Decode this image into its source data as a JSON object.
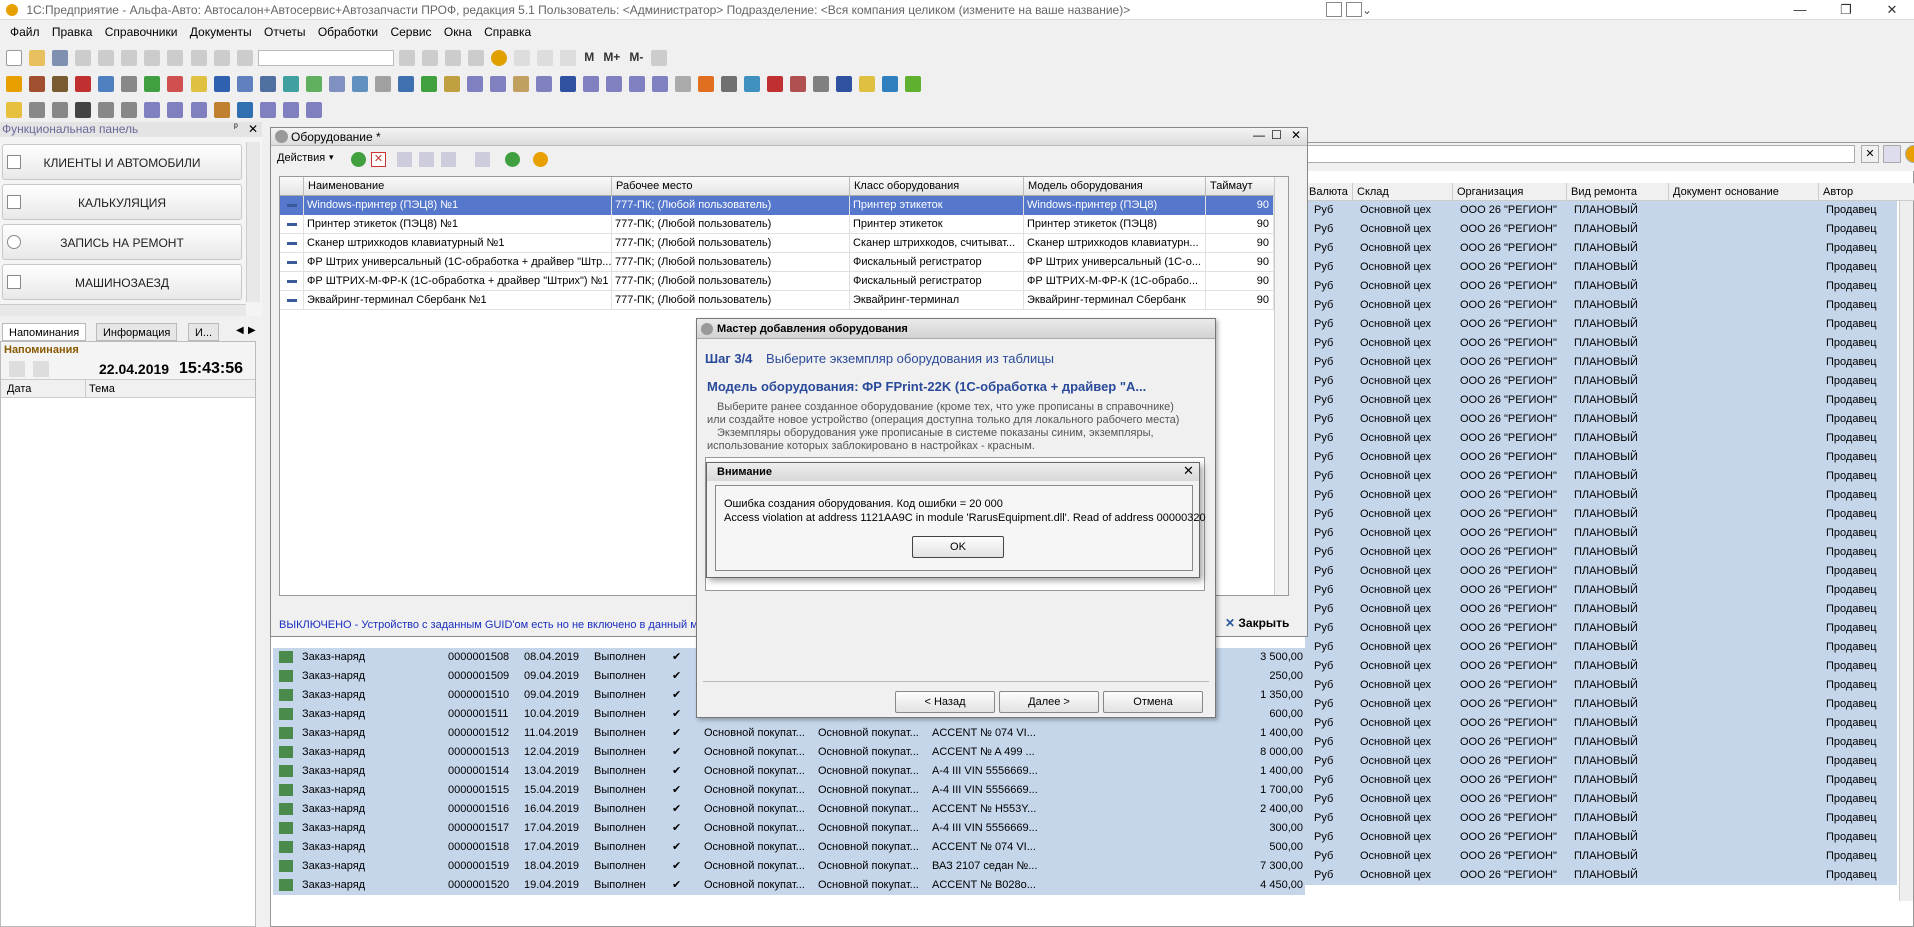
{
  "app": {
    "title": "1С:Предприятие - Альфа-Авто: Автосалон+Автосервис+Автозапчасти ПРОФ, редакция 5.1     Пользователь: <Администратор>     Подразделение: <Вся компания целиком (измените на ваше название)>",
    "minimize": "—",
    "restore": "❐",
    "close": "✕"
  },
  "menu": [
    "Файл",
    "Правка",
    "Справочники",
    "Документы",
    "Отчеты",
    "Обработки",
    "Сервис",
    "Окна",
    "Справка"
  ],
  "toolbar_text": {
    "m": "M",
    "mplus": "M+",
    "mminus": "M-"
  },
  "func_panel": {
    "title": "Функциональная панель",
    "pin": "ᵖ",
    "items": [
      "КЛИЕНТЫ И АВТОМОБИЛИ",
      "КАЛЬКУЛЯЦИЯ",
      "ЗАПИСЬ НА РЕМОНТ",
      "МАШИНОЗАЕЗД"
    ]
  },
  "left_tabs": [
    "Напоминания",
    "Информация",
    "И..."
  ],
  "reminders": {
    "title": "Напоминания",
    "date": "22.04.2019",
    "time": "15:43:56",
    "col_date": "Дата",
    "col_topic": "Тема"
  },
  "main_list": {
    "headers": [
      "Валюта",
      "Склад",
      "Организация",
      "Вид ремонта",
      "Документ основание",
      "Автор"
    ],
    "bg_rows": {
      "currency": "Руб",
      "warehouse": "Основной цех",
      "org": "ООО 26 \"РЕГИОН\"",
      "repair": "ПЛАНОВЫЙ",
      "author": "Продавец"
    },
    "rows": [
      {
        "doc": "Заказ-наряд",
        "num": "0000001508",
        "date": "08.04.2019",
        "status": "Выполнен",
        "client": "",
        "contract": "",
        "car": "",
        "sum": "3 500,00"
      },
      {
        "doc": "Заказ-наряд",
        "num": "0000001509",
        "date": "09.04.2019",
        "status": "Выполнен",
        "client": "",
        "contract": "",
        "car": "",
        "sum": "250,00"
      },
      {
        "doc": "Заказ-наряд",
        "num": "0000001510",
        "date": "09.04.2019",
        "status": "Выполнен",
        "client": "",
        "contract": "",
        "car": "",
        "sum": "1 350,00"
      },
      {
        "doc": "Заказ-наряд",
        "num": "0000001511",
        "date": "10.04.2019",
        "status": "Выполнен",
        "client": "",
        "contract": "",
        "car": "",
        "sum": "600,00"
      },
      {
        "doc": "Заказ-наряд",
        "num": "0000001512",
        "date": "11.04.2019",
        "status": "Выполнен",
        "client": "Основной покупат...",
        "contract": "Основной покупат...",
        "car": "ACCENT № 074 VI...",
        "sum": "1 400,00"
      },
      {
        "doc": "Заказ-наряд",
        "num": "0000001513",
        "date": "12.04.2019",
        "status": "Выполнен",
        "client": "Основной покупат...",
        "contract": "Основной покупат...",
        "car": "ACCENT № A 499 ...",
        "sum": "8 000,00"
      },
      {
        "doc": "Заказ-наряд",
        "num": "0000001514",
        "date": "13.04.2019",
        "status": "Выполнен",
        "client": "Основной покупат...",
        "contract": "Основной покупат...",
        "car": "A-4 III VIN 5556669...",
        "sum": "1 400,00"
      },
      {
        "doc": "Заказ-наряд",
        "num": "0000001515",
        "date": "15.04.2019",
        "status": "Выполнен",
        "client": "Основной покупат...",
        "contract": "Основной покупат...",
        "car": "A-4 III VIN 5556669...",
        "sum": "1 700,00"
      },
      {
        "doc": "Заказ-наряд",
        "num": "0000001516",
        "date": "16.04.2019",
        "status": "Выполнен",
        "client": "Основной покупат...",
        "contract": "Основной покупат...",
        "car": "ACCENT № H553Y...",
        "sum": "2 400,00"
      },
      {
        "doc": "Заказ-наряд",
        "num": "0000001517",
        "date": "17.04.2019",
        "status": "Выполнен",
        "client": "Основной покупат...",
        "contract": "Основной покупат...",
        "car": "A-4 III VIN 5556669...",
        "sum": "300,00"
      },
      {
        "doc": "Заказ-наряд",
        "num": "0000001518",
        "date": "17.04.2019",
        "status": "Выполнен",
        "client": "Основной покупат...",
        "contract": "Основной покупат...",
        "car": "ACCENT № 074 VI...",
        "sum": "500,00"
      },
      {
        "doc": "Заказ-наряд",
        "num": "0000001519",
        "date": "18.04.2019",
        "status": "Выполнен",
        "client": "Основной покупат...",
        "contract": "Основной покупат...",
        "car": "ВАЗ 2107 седан №...",
        "sum": "7 300,00"
      },
      {
        "doc": "Заказ-наряд",
        "num": "0000001520",
        "date": "19.04.2019",
        "status": "Выполнен",
        "client": "Основной покупат...",
        "contract": "Основной покупат...",
        "car": "ACCENT № B028o...",
        "sum": "4 450,00"
      }
    ]
  },
  "equipment": {
    "title": "Оборудование *",
    "actions": "Действия",
    "headers": [
      "Наименование",
      "Рабочее место",
      "Класс оборудования",
      "Модель оборудования",
      "Таймаут"
    ],
    "rows": [
      {
        "name": "Windows-принтер (ПЭЦ8) №1",
        "place": "777-ПК; (Любой пользователь)",
        "cls": "Принтер этикеток",
        "model": "Windows-принтер (ПЭЦ8)",
        "timeout": "90"
      },
      {
        "name": "Принтер этикеток (ПЭЦ8) №1",
        "place": "777-ПК; (Любой пользователь)",
        "cls": "Принтер этикеток",
        "model": "Принтер этикеток (ПЭЦ8)",
        "timeout": "90"
      },
      {
        "name": "Сканер штрихкодов клавиатурный №1",
        "place": "777-ПК; (Любой пользователь)",
        "cls": "Сканер штрихкодов, считыват...",
        "model": "Сканер штрихкодов клавиатурн...",
        "timeout": "90"
      },
      {
        "name": "ФР Штрих универсальный (1С-обработка + драйвер \"Штр...",
        "place": "777-ПК; (Любой пользователь)",
        "cls": "Фискальный регистратор",
        "model": "ФР Штрих универсальный (1С-о...",
        "timeout": "90"
      },
      {
        "name": "ФР ШТРИХ-М-ФР-К (1С-обработка + драйвер \"Штрих\") №1",
        "place": "777-ПК; (Любой пользователь)",
        "cls": "Фискальный регистратор",
        "model": "ФР ШТРИХ-М-ФР-К (1С-обрабо...",
        "timeout": "90"
      },
      {
        "name": "Эквайринг-терминал Сбербанк №1",
        "place": "777-ПК; (Любой пользователь)",
        "cls": "Эквайринг-терминал",
        "model": "Эквайринг-терминал Сбербанк",
        "timeout": "90"
      }
    ],
    "status": "ВЫКЛЮЧЕНО - Устройство с заданным GUID'ом есть но не включено в данный м",
    "close_btn": "Закрыть"
  },
  "wizard": {
    "title": "Мастер добавления оборудования",
    "step": "Шаг 3/4",
    "step_desc": "Выберите экземпляр оборудования из таблицы",
    "model": "Модель оборудования: ФР FPrint-22K (1С-обработка + драйвер \"А...",
    "hint1": "Выберите ранее созданное оборудование (кроме тех, что уже прописаны в справочнике)",
    "hint2": "или создайте новое устройство (операция доступна только для локального рабочего места)",
    "hint3": "Экземпляры оборудования уже прописаные в системе показаны синим, экземпляры,",
    "hint4": "использование которых заблокировано в настройках - красным.",
    "back": "< Назад",
    "next": "Далее >",
    "cancel": "Отмена"
  },
  "alert": {
    "title": "Внимание",
    "line1": "Ошибка создания оборудования. Код ошибки = 20 000",
    "line2": "Access violation at address 1121AA9C in module 'RarusEquipment.dll'. Read of address 00000320",
    "ok": "OK"
  }
}
